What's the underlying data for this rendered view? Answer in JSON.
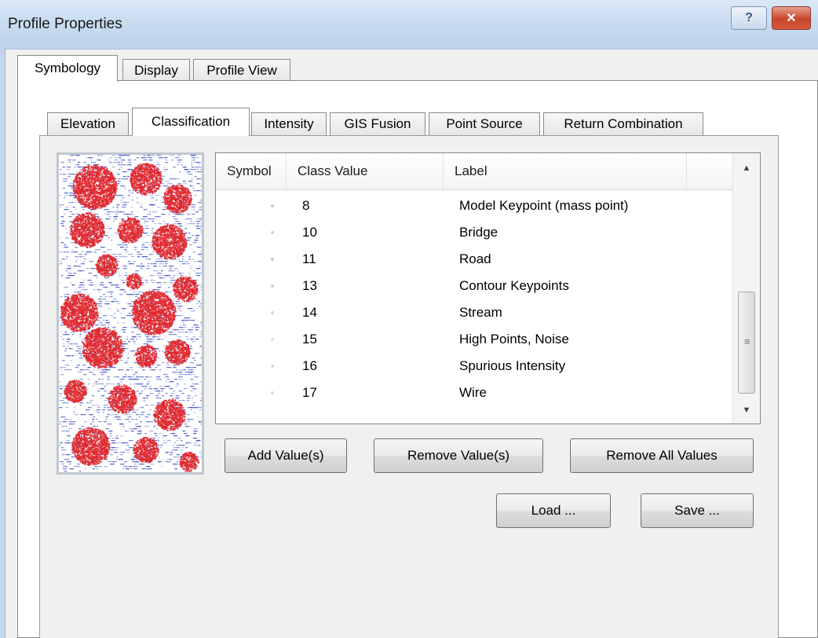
{
  "window": {
    "title": "Profile Properties",
    "help_glyph": "?",
    "close_glyph": "✕"
  },
  "main_tabs": [
    {
      "label": "Symbology",
      "active": true
    },
    {
      "label": "Display",
      "active": false
    },
    {
      "label": "Profile View",
      "active": false
    }
  ],
  "sub_tabs": [
    {
      "label": "Elevation",
      "active": false
    },
    {
      "label": "Classification",
      "active": true
    },
    {
      "label": "Intensity",
      "active": false
    },
    {
      "label": "GIS Fusion",
      "active": false
    },
    {
      "label": "Point Source",
      "active": false
    },
    {
      "label": "Return Combination",
      "active": false
    }
  ],
  "class_list": {
    "columns": [
      "Symbol",
      "Class Value",
      "Label"
    ],
    "rows": [
      {
        "value": "8",
        "label": "Model Keypoint (mass point)",
        "symbol_color": "#c8c8c8"
      },
      {
        "value": "10",
        "label": "Bridge",
        "symbol_color": "#d2d2d2"
      },
      {
        "value": "11",
        "label": "Road",
        "symbol_color": "#c8c8c8"
      },
      {
        "value": "13",
        "label": "Contour Keypoints",
        "symbol_color": "#cfcfcf"
      },
      {
        "value": "14",
        "label": "Stream",
        "symbol_color": "#d6d6d6"
      },
      {
        "value": "15",
        "label": "High Points, Noise",
        "symbol_color": "#e0e0e0"
      },
      {
        "value": "16",
        "label": "Spurious Intensity",
        "symbol_color": "#d8d8d8"
      },
      {
        "value": "17",
        "label": "Wire",
        "symbol_color": "#dcdcdc"
      }
    ]
  },
  "buttons": {
    "add_values": "Add Value(s)",
    "remove_values": "Remove Value(s)",
    "remove_all": "Remove All Values",
    "load": "Load ...",
    "save": "Save ..."
  },
  "scrollbar": {
    "up_icon": "▲",
    "down_icon": "▼",
    "grip": "≡"
  },
  "colors": {
    "preview_background": "#ffffff",
    "preview_point_blue": "#3a4fc8",
    "preview_point_red": "#e0282e"
  }
}
